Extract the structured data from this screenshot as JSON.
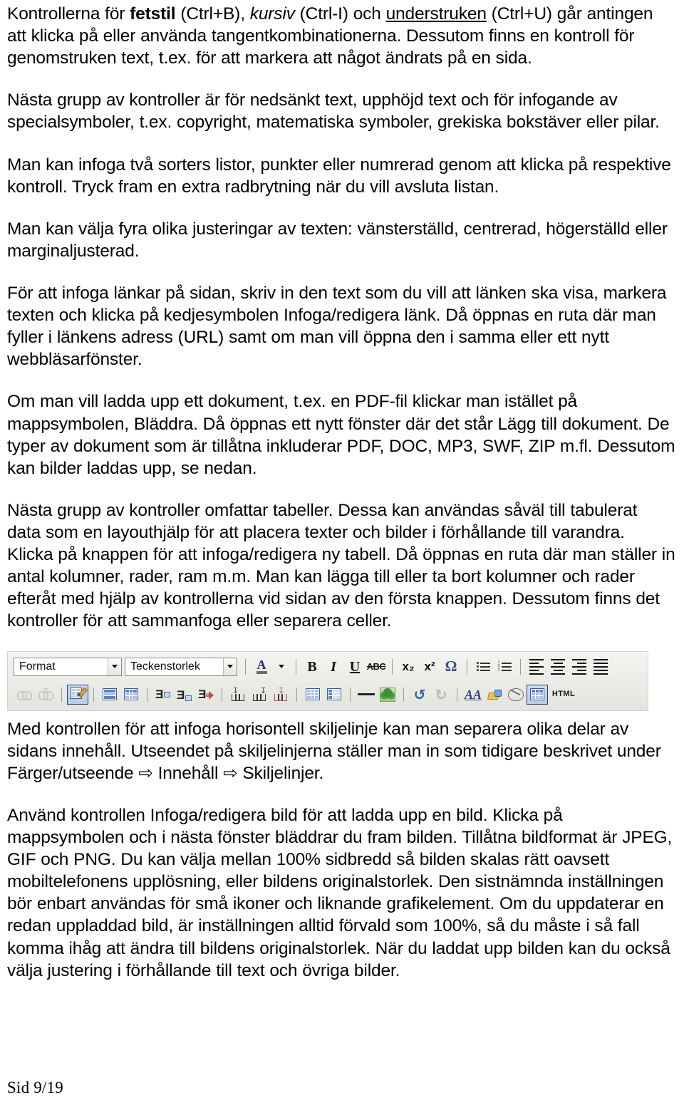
{
  "document": {
    "footer": "Sid 9/19",
    "paragraphs": [
      {
        "id": "p1",
        "runs": [
          {
            "t": "Kontrollerna för ",
            "style": "normal"
          },
          {
            "t": "fetstil",
            "style": "bold"
          },
          {
            "t": " (Ctrl+B), ",
            "style": "normal"
          },
          {
            "t": "kursiv",
            "style": "italic"
          },
          {
            "t": " (Ctrl-I) och ",
            "style": "normal"
          },
          {
            "t": "understruken",
            "style": "underline"
          },
          {
            "t": " (Ctrl+U) går antingen att klicka på eller använda tangentkombinationerna.  Dessutom finns en kontroll för genomstruken text, t.ex. för att markera att något ändrats på en sida.",
            "style": "normal"
          }
        ]
      },
      {
        "id": "p2",
        "text": "Nästa grupp av kontroller är för nedsänkt text, upphöjd text och för infogande av specialsymboler, t.ex. copyright, matematiska symboler, grekiska bokstäver eller pilar."
      },
      {
        "id": "p3",
        "text": "Man kan infoga två sorters listor, punkter eller numrerad genom att klicka på respektive kontroll. Tryck fram en extra radbrytning när du vill avsluta listan."
      },
      {
        "id": "p4",
        "text": "Man kan välja fyra olika justeringar av texten: vänsterställd, centrerad, högerställd eller marginaljusterad."
      },
      {
        "id": "p5",
        "text": "För att infoga länkar på sidan, skriv in den text som du vill att länken ska visa, markera texten och klicka på kedjesymbolen Infoga/redigera länk. Då öppnas en ruta där man fyller i länkens adress (URL) samt om man vill öppna den i samma eller ett nytt webbläsarfönster."
      },
      {
        "id": "p6",
        "text": "Om man vill ladda upp ett dokument, t.ex. en PDF-fil klickar man istället på mappsymbolen, Bläddra. Då öppnas ett nytt fönster där det står Lägg till dokument. De typer av dokument som är tillåtna inkluderar PDF, DOC, MP3, SWF, ZIP m.fl. Dessutom kan bilder laddas upp, se nedan."
      },
      {
        "id": "p7",
        "text": "Nästa grupp av kontroller omfattar tabeller. Dessa kan användas såväl till tabulerat data som en layouthjälp för att placera texter och bilder i förhållande till varandra. Klicka på knappen för att infoga/redigera ny tabell. Då öppnas en ruta där man ställer in antal kolumner, rader, ram m.m. Man kan lägga till eller ta bort kolumner och rader efteråt med hjälp av kontrollerna vid sidan av den första knappen. Dessutom finns det kontroller för att sammanfoga eller separera celler."
      },
      {
        "id": "p8",
        "text": "Med kontrollen för att infoga horisontell skiljelinje kan man separera olika delar av sidans innehåll. Utseendet på skiljelinjerna ställer man in som tidigare beskrivet under Färger/utseende ⇨ Innehåll ⇨ Skiljelinjer."
      },
      {
        "id": "p9",
        "text": "Använd kontrollen Infoga/redigera bild för att ladda upp en bild. Klicka på mappsymbolen och i nästa fönster bläddrar du fram bilden. Tillåtna bildformat är JPEG, GIF och PNG. Du kan välja mellan 100% sidbredd så bilden skalas rätt oavsett mobiltelefonens upplösning, eller bildens originalstorlek. Den sistnämnda inställningen bör enbart användas för små ikoner och liknande grafikelement. Om du uppdaterar en redan uppladdad bild, är inställningen alltid förvald som 100%, så du måste i så fall komma ihåg att ändra till bildens originalstorlek. När du laddat upp bilden kan du också välja justering i förhållande till text och övriga bilder."
      }
    ]
  },
  "toolbar": {
    "row1": {
      "format_select": "Format",
      "fontsize_select": "Teckenstorlek",
      "buttons": [
        {
          "name": "text-color-icon",
          "label": "A"
        },
        {
          "name": "bold-icon",
          "label": "B"
        },
        {
          "name": "italic-icon",
          "label": "I"
        },
        {
          "name": "underline-icon",
          "label": "U"
        },
        {
          "name": "strikethrough-icon",
          "label": "ABC"
        },
        {
          "name": "subscript-icon",
          "label": "x₂"
        },
        {
          "name": "superscript-icon",
          "label": "x²"
        },
        {
          "name": "special-character-icon",
          "label": "Ω"
        },
        {
          "name": "bullet-list-icon",
          "label": ""
        },
        {
          "name": "numbered-list-icon",
          "label": ""
        },
        {
          "name": "align-left-icon",
          "label": ""
        },
        {
          "name": "align-center-icon",
          "label": ""
        },
        {
          "name": "align-right-icon",
          "label": ""
        },
        {
          "name": "align-justify-icon",
          "label": ""
        }
      ]
    },
    "row2": {
      "buttons": [
        {
          "name": "insert-link-icon",
          "label": ""
        },
        {
          "name": "unlink-icon",
          "label": ""
        },
        {
          "name": "insert-edit-table-icon",
          "label": ""
        },
        {
          "name": "table-row-properties-icon",
          "label": ""
        },
        {
          "name": "table-cell-properties-icon",
          "label": ""
        },
        {
          "name": "insert-row-before-icon",
          "label": ""
        },
        {
          "name": "insert-row-after-icon",
          "label": ""
        },
        {
          "name": "delete-row-icon",
          "label": ""
        },
        {
          "name": "insert-column-before-icon",
          "label": ""
        },
        {
          "name": "insert-column-after-icon",
          "label": ""
        },
        {
          "name": "delete-column-icon",
          "label": ""
        },
        {
          "name": "merge-cells-icon",
          "label": ""
        },
        {
          "name": "split-cells-icon",
          "label": ""
        },
        {
          "name": "horizontal-rule-icon",
          "label": ""
        },
        {
          "name": "insert-edit-image-icon",
          "label": ""
        },
        {
          "name": "undo-icon",
          "label": "↺"
        },
        {
          "name": "redo-icon",
          "label": "↻"
        },
        {
          "name": "font-size-icon",
          "label": "AA"
        },
        {
          "name": "cleanup-icon",
          "label": ""
        },
        {
          "name": "remove-format-icon",
          "label": ""
        },
        {
          "name": "toggle-table-borders-icon",
          "label": ""
        },
        {
          "name": "edit-html-icon",
          "label": "HTML"
        }
      ]
    },
    "colors": {
      "accent_blue": "#3a5a9a",
      "cell_fill": "#a9c2e6",
      "header_fill": "#5e81bd",
      "pressed_border": "#2b3f6b",
      "red_accent": "#b84c4c",
      "toolbar_bg": "#ecece8"
    }
  }
}
